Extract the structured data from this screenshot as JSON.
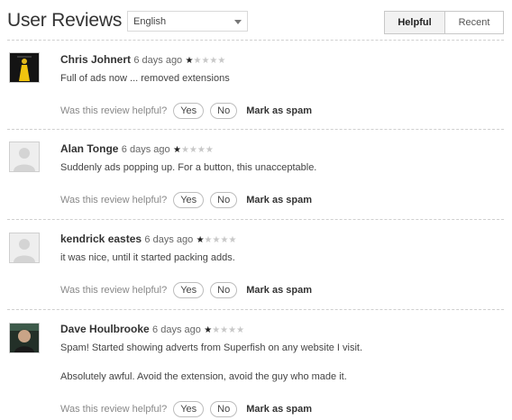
{
  "header": {
    "title": "User Reviews",
    "language": "English",
    "sort_helpful": "Helpful",
    "sort_recent": "Recent"
  },
  "helpful_prompt": "Was this review helpful?",
  "yes_label": "Yes",
  "no_label": "No",
  "spam_label": "Mark as spam",
  "reviews": [
    {
      "author": "Chris Johnert",
      "time": "6 days ago",
      "rating": 1,
      "text": "Full of ads now ... removed extensions",
      "avatar": "photo-yellow-figure"
    },
    {
      "author": "Alan Tonge",
      "time": "6 days ago",
      "rating": 1,
      "text": "Suddenly ads popping up. For a button, this unacceptable.",
      "avatar": "placeholder"
    },
    {
      "author": "kendrick eastes",
      "time": "6 days ago",
      "rating": 1,
      "text": "it was nice, until it started packing adds.",
      "avatar": "placeholder"
    },
    {
      "author": "Dave Houlbrooke",
      "time": "6 days ago",
      "rating": 1,
      "text": "Spam! Started showing adverts from Superfish on any website I visit.",
      "text2": "Absolutely awful. Avoid the extension, avoid the guy who made it.",
      "avatar": "photo-person"
    }
  ]
}
